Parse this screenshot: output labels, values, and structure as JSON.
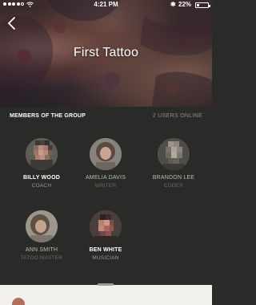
{
  "status_bar": {
    "time": "4:21 PM",
    "battery": "22%",
    "icons": [
      "signal-dots-icon",
      "wifi-icon",
      "bluetooth-icon",
      "battery-icon"
    ]
  },
  "header": {
    "title": "First Tattoo",
    "back_icon": "chevron-left-icon"
  },
  "members_panel": {
    "title": "MEMBERS OF THE GROUP",
    "online_status": "2 USERS ONLINE",
    "members": [
      {
        "name": "BILLY WOOD",
        "role": "COACH",
        "online": true
      },
      {
        "name": "AMELIA DAVIS",
        "role": "WRITER",
        "online": false
      },
      {
        "name": "BRANDON LEE",
        "role": "CODER",
        "online": false
      },
      {
        "name": "ANN SMITH",
        "role": "TATOO MASTER",
        "online": false
      },
      {
        "name": "BEN WHITE",
        "role": "MUSICIAN",
        "online": true
      }
    ]
  },
  "colors": {
    "panel_bg": "#2a2a28",
    "muted_text": "#6a6a66",
    "online_text": "#8e8e8a"
  }
}
